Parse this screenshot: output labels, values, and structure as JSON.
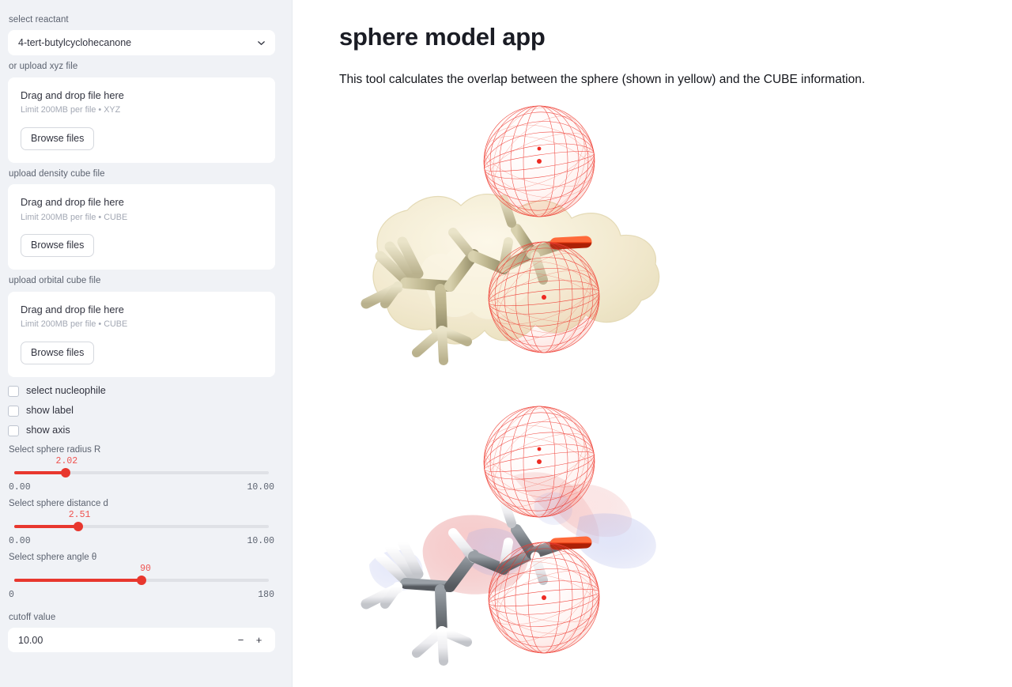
{
  "sidebar": {
    "reactant": {
      "label": "select reactant",
      "value": "4-tert-butylcyclohecanone",
      "chevron": "chevron-down-icon"
    },
    "uploads": [
      {
        "label": "or upload xyz file",
        "drop_title": "Drag and drop file here",
        "drop_limit": "Limit 200MB per file • XYZ",
        "browse_label": "Browse files"
      },
      {
        "label": "upload density cube file",
        "drop_title": "Drag and drop file here",
        "drop_limit": "Limit 200MB per file • CUBE",
        "browse_label": "Browse files"
      },
      {
        "label": "upload orbital cube file",
        "drop_title": "Drag and drop file here",
        "drop_limit": "Limit 200MB per file • CUBE",
        "browse_label": "Browse files"
      }
    ],
    "checkboxes": [
      {
        "label": "select nucleophile",
        "checked": false
      },
      {
        "label": "show label",
        "checked": false
      },
      {
        "label": "show axis",
        "checked": false
      }
    ],
    "sliders": [
      {
        "label": "Select sphere radius R",
        "value": "2.02",
        "min": "0.00",
        "max": "10.00",
        "percent": 20.2
      },
      {
        "label": "Select sphere distance d",
        "value": "2.51",
        "min": "0.00",
        "max": "10.00",
        "percent": 25.1
      },
      {
        "label": "Select sphere angle θ",
        "value": "90",
        "min": "0",
        "max": "180",
        "percent": 50
      }
    ],
    "cutoff": {
      "label": "cutoff value",
      "value": "10.00",
      "minus_label": "−",
      "plus_label": "+"
    }
  },
  "main": {
    "title": "sphere model app",
    "subtitle": "This tool calculates the overlap between the sphere (shown in yellow) and the CUBE information.",
    "viewers": [
      {
        "name": "density-viewer",
        "caption_hidden": "3D molecular density surface of 4-tert-butylcyclohecanone with two red wireframe probe spheres"
      },
      {
        "name": "orbital-viewer",
        "caption_hidden": "3D molecular orbital isosurface of 4-tert-butylcyclohecanone with two red wireframe probe spheres"
      }
    ]
  },
  "colors": {
    "sidebar_bg": "#f0f2f6",
    "accent_red": "#e8372e",
    "slider_value_red": "#ef5350",
    "text_primary": "#31333f",
    "text_muted": "#5c6370",
    "density_yellow": "#efe6c8",
    "oxygen_red": "#e03010",
    "sphere_mesh_red": "#ee2222",
    "orbital_blue": "#7f8fe0"
  }
}
